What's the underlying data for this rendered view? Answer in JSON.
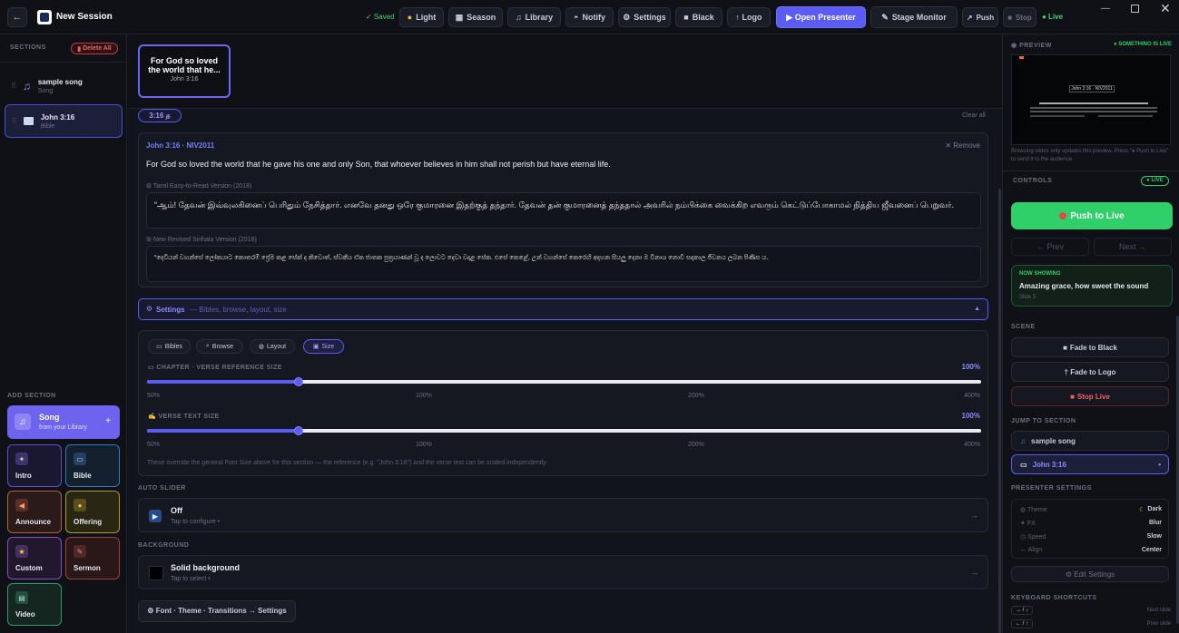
{
  "topbar": {
    "title": "New Session",
    "saved": "✓ Saved",
    "light": "Light",
    "season": "Season",
    "library": "Library",
    "notify": "Notify",
    "settings": "Settings",
    "black": "Black",
    "logo": "↑ Logo",
    "open_presenter": "▶ Open Presenter",
    "stage_monitor": "Stage Monitor",
    "push": "Push",
    "stop": "Stop",
    "live": "● Live"
  },
  "sidebar": {
    "sections_label": "SECTIONS",
    "delete_all": "Delete All",
    "items": [
      {
        "title": "sample song",
        "sub": "Song"
      },
      {
        "title": "John 3:16",
        "sub": "Bible"
      }
    ],
    "add_label": "ADD SECTION",
    "song_title": "Song",
    "song_sub": "from your Library",
    "song_plus": "+",
    "tiles": [
      "Intro",
      "Bible",
      "Announce",
      "Offering",
      "Custom",
      "Sermon",
      "Video"
    ]
  },
  "main": {
    "thumb": {
      "line1": "For God so loved",
      "line2": "the world that he...",
      "ref": "John 3:16"
    },
    "chip": "3:16 த",
    "clear_all": "Clear all",
    "verse": {
      "ref": "John 3:16 · NIV2011",
      "remove": "✕ Remove",
      "text": "For God so loved the world that he gave his one and only Son, that whoever believes in him shall not perish but have eternal life.",
      "tamil_label": "Tamil Easy-to-Read Version (2018)",
      "tamil_text": "“ஆம்! தேவன் இவ்வுலகினைப் பெரிதும் நேசித்தார். எனவே தனது ஒரே குமாரனை இதற்குத் தந்தார். தேவன் தன் குமாரனைத் தந்ததால் அவரில் நம்பிக்கை வைக்கிற எவரும் கெட்டுப்போகாமல் நித்திய ஜீவனைப் பெறுவர்.",
      "sinhala_label": "New Revised Sinhala Version (2018)",
      "sinhala_text": "“දෙවියන් වහන්සේ ලෝකයාට කොතරම් ප්‍රේම කළ සේක් ද කිවොත්, ස්වකීය ඒක ජාතක පුත්‍රයාණන් වූ ද ලොවට දෙවා වදාළ සේක. එසේ කෙළේ, උන් වහන්සේ කෙරෙහි අදහන සියලු දෙනා ම විනාශ නොවී සදාකාල ජීවනය ලබන පිණිස ය."
    },
    "settings_bar": {
      "title": "Settings",
      "sub": "— Bibles, browse, layout, size",
      "chev": "▲"
    },
    "tabs": [
      "Bibles",
      "Browse",
      "Layout",
      "Size"
    ],
    "size": {
      "chapter_label": "CHAPTER · VERSE REFERENCE SIZE",
      "chapter_value": "100%",
      "chapter_fraction": 0.1818,
      "verse_label": "VERSE TEXT SIZE",
      "verse_value": "100%",
      "verse_fraction": 0.1818,
      "ticks": [
        "50%",
        "100%",
        "200%",
        "400%"
      ],
      "note": "These override the general Font Size above for this section — the reference (e.g. \"John 3:16\") and the verse text can be scaled independently."
    },
    "auto_slider": {
      "label": "AUTO SLIDER",
      "title": "Off",
      "sub": "Tap to configure •",
      "arrow": "→"
    },
    "background": {
      "label": "BACKGROUND",
      "title": "Solid background",
      "sub": "Tap to select •",
      "arrow": "→"
    },
    "footer_link": "⚙ Font · Theme · Transitions → Settings"
  },
  "right": {
    "preview_label": "PREVIEW",
    "something_live": "● SOMETHING IS LIVE",
    "preview_title": "John 3:16 · NIV2011",
    "preview_note": "Browsing slides only updates this preview. Press \"● Push to Live\" to send it to the audience.",
    "controls_label": "CONTROLS",
    "live_badge": "● LIVE",
    "push_live": "Push to Live",
    "prev": "← Prev",
    "next": "Next →",
    "now_showing_label": "NOW SHOWING",
    "now_showing_text": "Amazing grace, how sweet the sound",
    "now_showing_slide": "Slide 5",
    "scene_label": "SCENE",
    "fade_black": "Fade to Black",
    "fade_logo": "† Fade to Logo",
    "stop_live": "Stop Live",
    "jump_label": "JUMP TO SECTION",
    "jump": [
      "sample song",
      "John 3:16"
    ],
    "presenter_label": "PRESENTER SETTINGS",
    "settings_rows": [
      {
        "k": "Theme",
        "v": "Dark"
      },
      {
        "k": "FX",
        "v": "Blur"
      },
      {
        "k": "Speed",
        "v": "Slow"
      },
      {
        "k": "Align",
        "v": "Center"
      }
    ],
    "edit_settings": "⚙ Edit Settings",
    "keyboard_label": "KEYBOARD SHORTCUTS",
    "shortcuts": [
      {
        "k": "→ / ↓",
        "v": "Next slide"
      },
      {
        "k": "← / ↑",
        "v": "Prev slide"
      }
    ]
  },
  "colors": {
    "accent": "#5b5bf5",
    "green": "#2fcf6a",
    "red": "#e24a4a"
  }
}
